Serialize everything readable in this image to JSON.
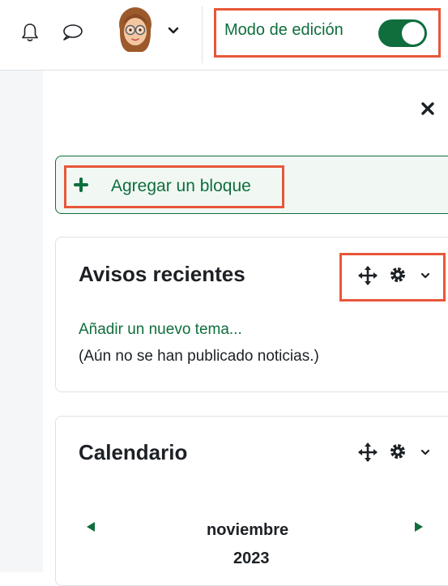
{
  "header": {
    "notifications_icon": "bell-icon",
    "messages_icon": "chat-bubble-icon",
    "avatar_icon": "user-avatar",
    "menu_icon": "chevron-down-icon",
    "edit_mode": {
      "label": "Modo de edición",
      "on": true
    }
  },
  "drawer": {
    "close_icon": "close-icon",
    "add_block": {
      "icon": "plus-icon",
      "label": "Agregar un bloque"
    },
    "blocks": [
      {
        "title": "Avisos recientes",
        "actions": [
          "move-icon",
          "gear-icon",
          "chevron-down-icon"
        ],
        "link": "Añadir un nuevo tema...",
        "message": "(Aún no se han publicado noticias.)"
      },
      {
        "title": "Calendario",
        "actions": [
          "move-icon",
          "gear-icon",
          "chevron-down-icon"
        ],
        "month": "noviembre",
        "year": "2023",
        "prev_icon": "triangle-left-icon",
        "next_icon": "triangle-right-icon"
      }
    ]
  },
  "colors": {
    "accent": "#0f6e3c",
    "highlight": "#e8573a",
    "border": "#dee2e6",
    "text": "#1d2125"
  }
}
